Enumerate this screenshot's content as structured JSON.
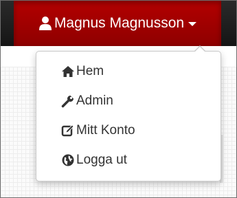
{
  "user_menu": {
    "name": "Magnus Magnusson",
    "icon": "user-icon"
  },
  "dropdown": {
    "items": [
      {
        "label": "Hem",
        "icon": "home-icon"
      },
      {
        "label": "Admin",
        "icon": "wrench-icon"
      },
      {
        "label": "Mitt Konto",
        "icon": "edit-icon"
      },
      {
        "label": "Logga ut",
        "icon": "globe-icon"
      }
    ]
  },
  "colors": {
    "accent": "#a30000",
    "navbar": "#1f1f1f",
    "text": "#333333"
  }
}
